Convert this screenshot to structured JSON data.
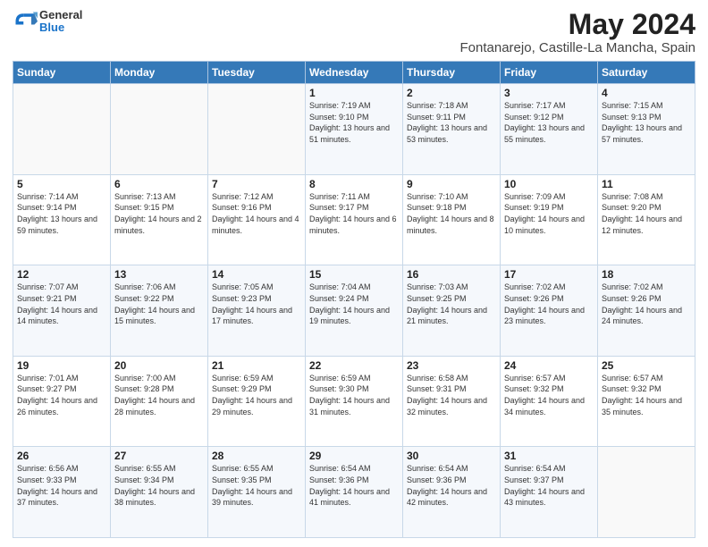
{
  "header": {
    "logo_general": "General",
    "logo_blue": "Blue",
    "title": "May 2024",
    "subtitle": "Fontanarejo, Castille-La Mancha, Spain"
  },
  "columns": [
    "Sunday",
    "Monday",
    "Tuesday",
    "Wednesday",
    "Thursday",
    "Friday",
    "Saturday"
  ],
  "weeks": [
    [
      {
        "day": "",
        "sunrise": "",
        "sunset": "",
        "daylight": ""
      },
      {
        "day": "",
        "sunrise": "",
        "sunset": "",
        "daylight": ""
      },
      {
        "day": "",
        "sunrise": "",
        "sunset": "",
        "daylight": ""
      },
      {
        "day": "1",
        "sunrise": "Sunrise: 7:19 AM",
        "sunset": "Sunset: 9:10 PM",
        "daylight": "Daylight: 13 hours and 51 minutes."
      },
      {
        "day": "2",
        "sunrise": "Sunrise: 7:18 AM",
        "sunset": "Sunset: 9:11 PM",
        "daylight": "Daylight: 13 hours and 53 minutes."
      },
      {
        "day": "3",
        "sunrise": "Sunrise: 7:17 AM",
        "sunset": "Sunset: 9:12 PM",
        "daylight": "Daylight: 13 hours and 55 minutes."
      },
      {
        "day": "4",
        "sunrise": "Sunrise: 7:15 AM",
        "sunset": "Sunset: 9:13 PM",
        "daylight": "Daylight: 13 hours and 57 minutes."
      }
    ],
    [
      {
        "day": "5",
        "sunrise": "Sunrise: 7:14 AM",
        "sunset": "Sunset: 9:14 PM",
        "daylight": "Daylight: 13 hours and 59 minutes."
      },
      {
        "day": "6",
        "sunrise": "Sunrise: 7:13 AM",
        "sunset": "Sunset: 9:15 PM",
        "daylight": "Daylight: 14 hours and 2 minutes."
      },
      {
        "day": "7",
        "sunrise": "Sunrise: 7:12 AM",
        "sunset": "Sunset: 9:16 PM",
        "daylight": "Daylight: 14 hours and 4 minutes."
      },
      {
        "day": "8",
        "sunrise": "Sunrise: 7:11 AM",
        "sunset": "Sunset: 9:17 PM",
        "daylight": "Daylight: 14 hours and 6 minutes."
      },
      {
        "day": "9",
        "sunrise": "Sunrise: 7:10 AM",
        "sunset": "Sunset: 9:18 PM",
        "daylight": "Daylight: 14 hours and 8 minutes."
      },
      {
        "day": "10",
        "sunrise": "Sunrise: 7:09 AM",
        "sunset": "Sunset: 9:19 PM",
        "daylight": "Daylight: 14 hours and 10 minutes."
      },
      {
        "day": "11",
        "sunrise": "Sunrise: 7:08 AM",
        "sunset": "Sunset: 9:20 PM",
        "daylight": "Daylight: 14 hours and 12 minutes."
      }
    ],
    [
      {
        "day": "12",
        "sunrise": "Sunrise: 7:07 AM",
        "sunset": "Sunset: 9:21 PM",
        "daylight": "Daylight: 14 hours and 14 minutes."
      },
      {
        "day": "13",
        "sunrise": "Sunrise: 7:06 AM",
        "sunset": "Sunset: 9:22 PM",
        "daylight": "Daylight: 14 hours and 15 minutes."
      },
      {
        "day": "14",
        "sunrise": "Sunrise: 7:05 AM",
        "sunset": "Sunset: 9:23 PM",
        "daylight": "Daylight: 14 hours and 17 minutes."
      },
      {
        "day": "15",
        "sunrise": "Sunrise: 7:04 AM",
        "sunset": "Sunset: 9:24 PM",
        "daylight": "Daylight: 14 hours and 19 minutes."
      },
      {
        "day": "16",
        "sunrise": "Sunrise: 7:03 AM",
        "sunset": "Sunset: 9:25 PM",
        "daylight": "Daylight: 14 hours and 21 minutes."
      },
      {
        "day": "17",
        "sunrise": "Sunrise: 7:02 AM",
        "sunset": "Sunset: 9:26 PM",
        "daylight": "Daylight: 14 hours and 23 minutes."
      },
      {
        "day": "18",
        "sunrise": "Sunrise: 7:02 AM",
        "sunset": "Sunset: 9:26 PM",
        "daylight": "Daylight: 14 hours and 24 minutes."
      }
    ],
    [
      {
        "day": "19",
        "sunrise": "Sunrise: 7:01 AM",
        "sunset": "Sunset: 9:27 PM",
        "daylight": "Daylight: 14 hours and 26 minutes."
      },
      {
        "day": "20",
        "sunrise": "Sunrise: 7:00 AM",
        "sunset": "Sunset: 9:28 PM",
        "daylight": "Daylight: 14 hours and 28 minutes."
      },
      {
        "day": "21",
        "sunrise": "Sunrise: 6:59 AM",
        "sunset": "Sunset: 9:29 PM",
        "daylight": "Daylight: 14 hours and 29 minutes."
      },
      {
        "day": "22",
        "sunrise": "Sunrise: 6:59 AM",
        "sunset": "Sunset: 9:30 PM",
        "daylight": "Daylight: 14 hours and 31 minutes."
      },
      {
        "day": "23",
        "sunrise": "Sunrise: 6:58 AM",
        "sunset": "Sunset: 9:31 PM",
        "daylight": "Daylight: 14 hours and 32 minutes."
      },
      {
        "day": "24",
        "sunrise": "Sunrise: 6:57 AM",
        "sunset": "Sunset: 9:32 PM",
        "daylight": "Daylight: 14 hours and 34 minutes."
      },
      {
        "day": "25",
        "sunrise": "Sunrise: 6:57 AM",
        "sunset": "Sunset: 9:32 PM",
        "daylight": "Daylight: 14 hours and 35 minutes."
      }
    ],
    [
      {
        "day": "26",
        "sunrise": "Sunrise: 6:56 AM",
        "sunset": "Sunset: 9:33 PM",
        "daylight": "Daylight: 14 hours and 37 minutes."
      },
      {
        "day": "27",
        "sunrise": "Sunrise: 6:55 AM",
        "sunset": "Sunset: 9:34 PM",
        "daylight": "Daylight: 14 hours and 38 minutes."
      },
      {
        "day": "28",
        "sunrise": "Sunrise: 6:55 AM",
        "sunset": "Sunset: 9:35 PM",
        "daylight": "Daylight: 14 hours and 39 minutes."
      },
      {
        "day": "29",
        "sunrise": "Sunrise: 6:54 AM",
        "sunset": "Sunset: 9:36 PM",
        "daylight": "Daylight: 14 hours and 41 minutes."
      },
      {
        "day": "30",
        "sunrise": "Sunrise: 6:54 AM",
        "sunset": "Sunset: 9:36 PM",
        "daylight": "Daylight: 14 hours and 42 minutes."
      },
      {
        "day": "31",
        "sunrise": "Sunrise: 6:54 AM",
        "sunset": "Sunset: 9:37 PM",
        "daylight": "Daylight: 14 hours and 43 minutes."
      },
      {
        "day": "",
        "sunrise": "",
        "sunset": "",
        "daylight": ""
      }
    ]
  ]
}
